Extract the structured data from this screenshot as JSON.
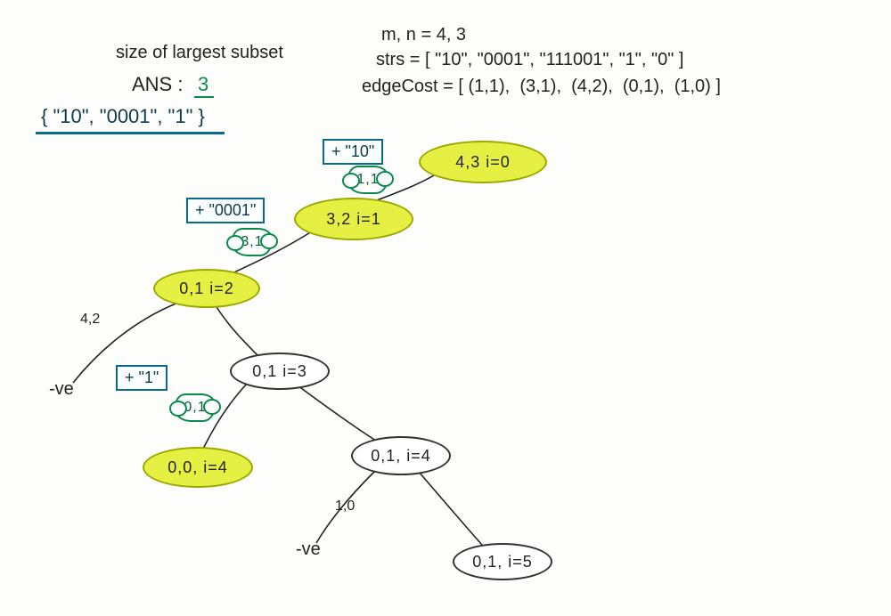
{
  "header": {
    "title_line": "size of largest subset",
    "ans_label": "ANS :",
    "ans_value": "3",
    "solution_set": "{ \"10\", \"0001\", \"1\" }"
  },
  "params": {
    "mn_line": "m, n = 4, 3",
    "strs_line": "strs = [ \"10\", \"0001\", \"111001\", \"1\", \"0\" ]",
    "edge_cost_line": "edgeCost = [ (1,1),  (3,1),  (4,2),  (0,1),  (1,0) ]"
  },
  "taken": {
    "n0": "+ \"10\"",
    "n1": "+ \"0001\"",
    "n3": "+ \"1\""
  },
  "clouds": {
    "c0": "1,1",
    "c1": "3,1",
    "c3": "0,1"
  },
  "nodes": {
    "root": "4,3  i=0",
    "i1": "3,2  i=1",
    "i2": "0,1  i=2",
    "i3": "0,1  i=3",
    "i4hl": "0,0, i=4",
    "i4": "0,1, i=4",
    "i5": "0,1, i=5"
  },
  "edge_labels": {
    "l_42": "4,2",
    "l_10": "1,0",
    "neg1": "-ve",
    "neg2": "-ve"
  },
  "chart_data": {
    "type": "tree",
    "m": 4,
    "n": 3,
    "strs": [
      "10",
      "0001",
      "111001",
      "1",
      "0"
    ],
    "edgeCost": [
      [
        1,
        1
      ],
      [
        3,
        1
      ],
      [
        4,
        2
      ],
      [
        0,
        1
      ],
      [
        1,
        0
      ]
    ],
    "answer": 3,
    "answer_subset": [
      "10",
      "0001",
      "1"
    ],
    "nodes": [
      {
        "id": "root",
        "m": 4,
        "n": 3,
        "i": 0,
        "highlight": true
      },
      {
        "id": "i1",
        "m": 3,
        "n": 2,
        "i": 1,
        "highlight": true
      },
      {
        "id": "i2",
        "m": 0,
        "n": 1,
        "i": 2,
        "highlight": true
      },
      {
        "id": "i3",
        "m": 0,
        "n": 1,
        "i": 3,
        "highlight": false
      },
      {
        "id": "i4hl",
        "m": 0,
        "n": 0,
        "i": 4,
        "highlight": true
      },
      {
        "id": "i4",
        "m": 0,
        "n": 1,
        "i": 4,
        "highlight": false
      },
      {
        "id": "i5",
        "m": 0,
        "n": 1,
        "i": 5,
        "highlight": false
      }
    ],
    "edges": [
      {
        "from": "root",
        "to": "i1",
        "take": true,
        "taken_str": "10",
        "cost": [
          1,
          1
        ]
      },
      {
        "from": "i1",
        "to": "i2",
        "take": true,
        "taken_str": "0001",
        "cost": [
          3,
          1
        ]
      },
      {
        "from": "i2",
        "to": "neg1",
        "take": true,
        "cost": [
          4,
          2
        ],
        "result": "-ve"
      },
      {
        "from": "i2",
        "to": "i3",
        "take": false
      },
      {
        "from": "i3",
        "to": "i4hl",
        "take": true,
        "taken_str": "1",
        "cost": [
          0,
          1
        ]
      },
      {
        "from": "i3",
        "to": "i4",
        "take": false
      },
      {
        "from": "i4",
        "to": "neg2",
        "take": true,
        "cost": [
          1,
          0
        ],
        "result": "-ve"
      },
      {
        "from": "i4",
        "to": "i5",
        "take": false
      }
    ]
  }
}
